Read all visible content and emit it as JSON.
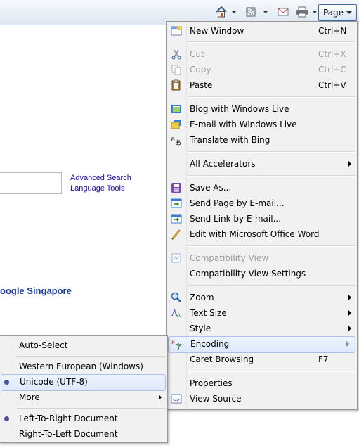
{
  "toolbar": {
    "home_icon": "home-icon",
    "feeds_icon": "feeds-icon",
    "mail_icon": "read-mail-icon",
    "print_icon": "print-icon",
    "page_label": "Page"
  },
  "content": {
    "advanced_search": "Advanced Search",
    "language_tools": "Language Tools",
    "google_singapore": "oogle Singapore"
  },
  "page_menu": {
    "items": [
      {
        "label": "New Window",
        "shortcut": "Ctrl+N",
        "icon": "new-window-icon"
      },
      {
        "label": "Cut",
        "shortcut": "Ctrl+X",
        "icon": "cut-icon",
        "disabled": true
      },
      {
        "label": "Copy",
        "shortcut": "Ctrl+C",
        "icon": "copy-icon",
        "disabled": true
      },
      {
        "label": "Paste",
        "shortcut": "Ctrl+V",
        "icon": "paste-icon"
      },
      {
        "label": "Blog with Windows Live",
        "icon": "blog-icon"
      },
      {
        "label": "E-mail with Windows Live",
        "icon": "email-icon"
      },
      {
        "label": "Translate with Bing",
        "icon": "translate-icon"
      },
      {
        "label": "All Accelerators",
        "submenu": true
      },
      {
        "label": "Save As...",
        "icon": "save-icon"
      },
      {
        "label": "Send Page by E-mail...",
        "icon": "send-page-icon"
      },
      {
        "label": "Send Link by E-mail...",
        "icon": "send-link-icon"
      },
      {
        "label": "Edit with Microsoft Office Word",
        "icon": "edit-pencil-icon"
      },
      {
        "label": "Compatibility View",
        "icon": "compatibility-icon",
        "disabled": true
      },
      {
        "label": "Compatibility View Settings"
      },
      {
        "label": "Zoom",
        "icon": "zoom-icon",
        "submenu": true
      },
      {
        "label": "Text Size",
        "icon": "text-size-icon",
        "submenu": true
      },
      {
        "label": "Style",
        "submenu": true
      },
      {
        "label": "Encoding",
        "icon": "encoding-icon",
        "submenu": true,
        "highlighted": true
      },
      {
        "label": "Caret Browsing",
        "shortcut": "F7"
      },
      {
        "label": "Properties"
      },
      {
        "label": "View Source",
        "icon": "view-source-icon"
      }
    ]
  },
  "encoding_menu": {
    "items": [
      {
        "label": "Auto-Select"
      },
      {
        "label": "Western European (Windows)"
      },
      {
        "label": "Unicode (UTF-8)",
        "checked": true,
        "highlighted": true
      },
      {
        "label": "More",
        "submenu": true
      },
      {
        "label": "Left-To-Right Document",
        "checked": true
      },
      {
        "label": "Right-To-Left Document"
      }
    ]
  }
}
